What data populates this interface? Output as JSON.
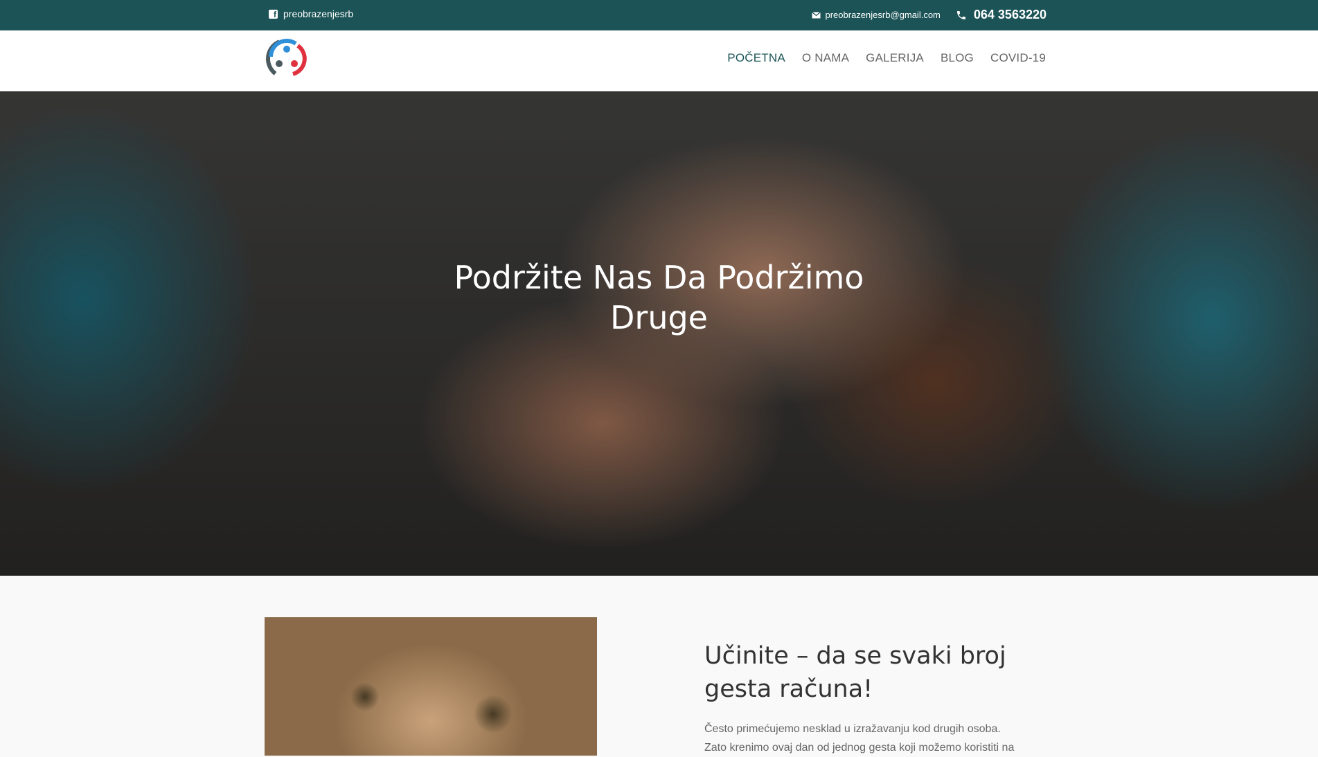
{
  "topbar": {
    "facebook_label": "preobrazenjesrb",
    "email": "preobrazenjesrb@gmail.com",
    "phone": "064 3563220"
  },
  "nav": {
    "items": [
      "POČETNA",
      "O NAMA",
      "GALERIJA",
      "BLOG",
      "COVID-19"
    ],
    "active": "POČETNA"
  },
  "hero": {
    "title_line1": "Podržite Nas Da Podržimo",
    "title_line2": "Druge"
  },
  "section": {
    "heading_line1": "Učinite – da se svaki broj",
    "heading_line2": "gesta računa!",
    "paragraph": "Često primećujemo nesklad u izražavanju kod drugih osoba. Zato krenimo ovaj dan od jednog gesta koji možemo koristiti na"
  },
  "colors": {
    "topbar_bg": "#1b5356",
    "accent": "#1b5356",
    "logo_blue": "#2f8fd8",
    "logo_red": "#e0313f",
    "logo_gray": "#4a5a5e"
  },
  "icons": [
    "facebook-icon",
    "envelope-icon",
    "phone-icon"
  ]
}
